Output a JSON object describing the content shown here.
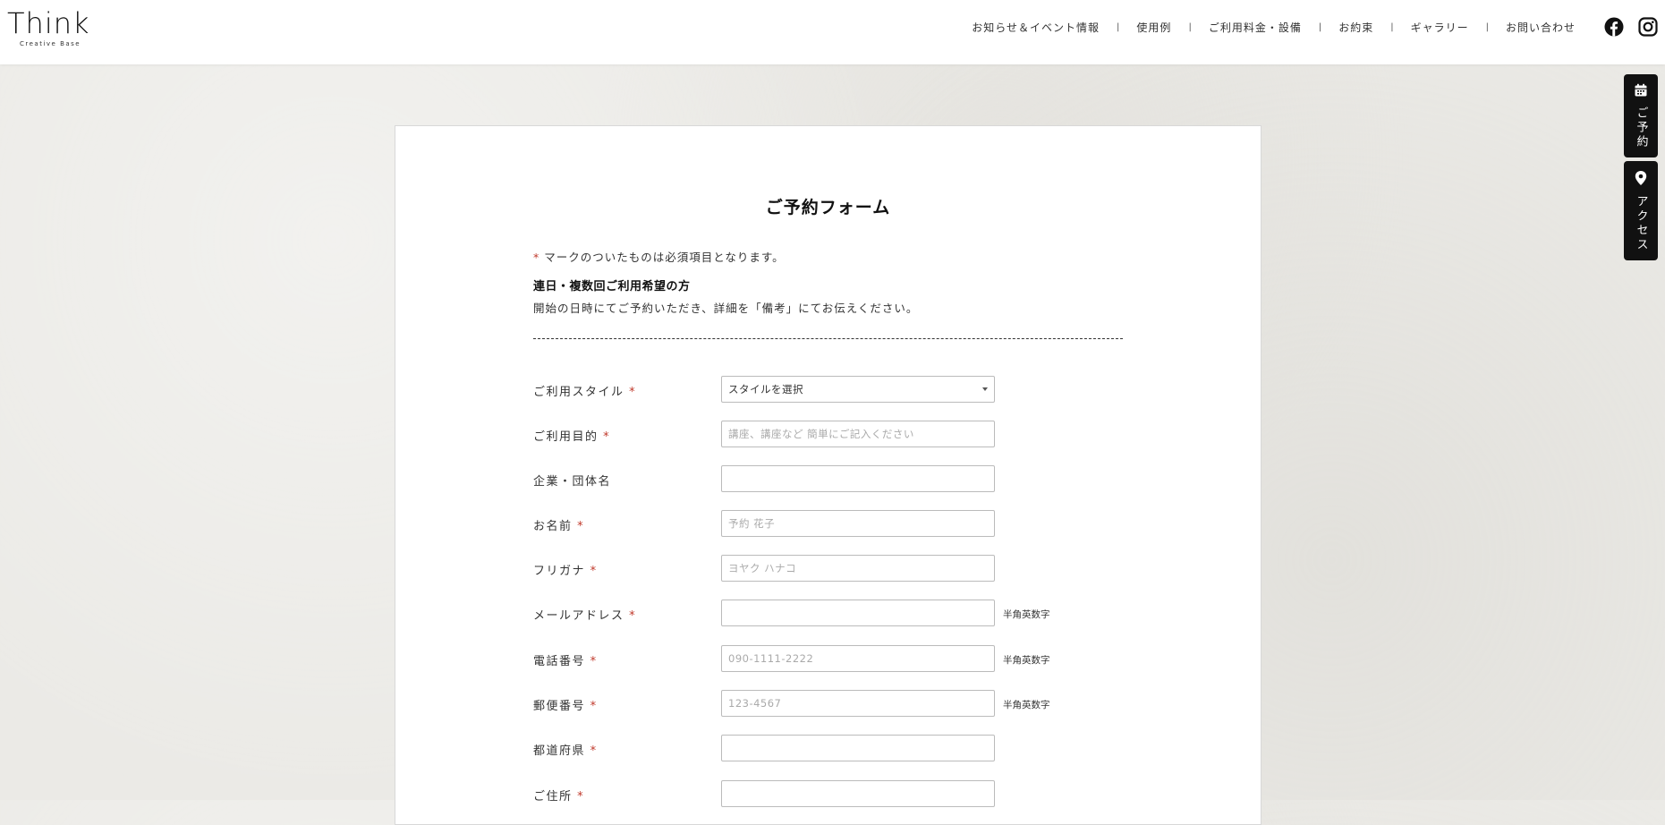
{
  "logo": {
    "main": "Think",
    "sub": "Creative Base"
  },
  "nav": {
    "items": [
      "お知らせ＆イベント情報",
      "使用例",
      "ご利用料金・設備",
      "お約束",
      "ギャラリー",
      "お問い合わせ"
    ],
    "separator": "|"
  },
  "side_tabs": {
    "reserve": "ご予約",
    "access": "アクセス"
  },
  "form": {
    "title": "ご予約フォーム",
    "required_mark": "*",
    "required_note": " マークのついたものは必須項目となります。",
    "multi_title": "連日・複数回ご利用希望の方",
    "multi_desc": "開始の日時にてご予約いただき、詳細を「備考」にてお伝えください。",
    "fields": [
      {
        "label": "ご利用スタイル",
        "required": true,
        "type": "select",
        "value": "スタイルを選択"
      },
      {
        "label": "ご利用目的",
        "required": true,
        "placeholder": "講座、講座など 簡単にご記入ください"
      },
      {
        "label": "企業・団体名",
        "required": false,
        "placeholder": ""
      },
      {
        "label": "お名前",
        "required": true,
        "placeholder": "予約 花子"
      },
      {
        "label": "フリガナ",
        "required": true,
        "placeholder": "ヨヤク ハナコ"
      },
      {
        "label": "メールアドレス",
        "required": true,
        "placeholder": "",
        "hint": "半角英数字"
      },
      {
        "label": "電話番号",
        "required": true,
        "placeholder": "090-1111-2222",
        "hint": "半角英数字"
      },
      {
        "label": "郵便番号",
        "required": true,
        "placeholder": "123-4567",
        "hint": "半角英数字"
      },
      {
        "label": "都道府県",
        "required": true,
        "placeholder": ""
      },
      {
        "label": "ご住所",
        "required": true,
        "placeholder": ""
      }
    ]
  },
  "colors": {
    "accent": "#c0392b",
    "dark": "#111111",
    "background": "#ebeae6"
  }
}
